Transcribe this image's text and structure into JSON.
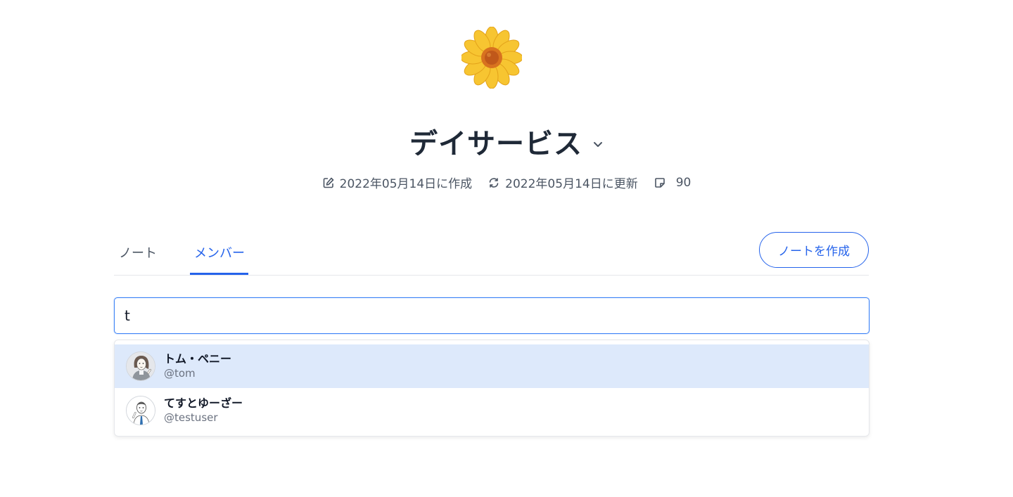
{
  "workspace": {
    "icon": "sunflower-emoji",
    "title": "デイサービス",
    "created_label": "2022年05月14日に作成",
    "updated_label": "2022年05月14日に更新",
    "note_count": "90"
  },
  "tabs": [
    {
      "label": "ノート",
      "active": false
    },
    {
      "label": "メンバー",
      "active": true
    }
  ],
  "actions": {
    "create_note_label": "ノートを作成"
  },
  "search": {
    "value": "t"
  },
  "suggestions": [
    {
      "name": "トム・ペニー",
      "handle": "@tom",
      "highlighted": true,
      "avatar": "woman-avatar"
    },
    {
      "name": "てすとゆーざー",
      "handle": "@testuser",
      "highlighted": false,
      "avatar": "man-avatar"
    }
  ],
  "colors": {
    "accent": "#2563eb",
    "highlight": "#dde9fb",
    "title": "#1f2937"
  }
}
